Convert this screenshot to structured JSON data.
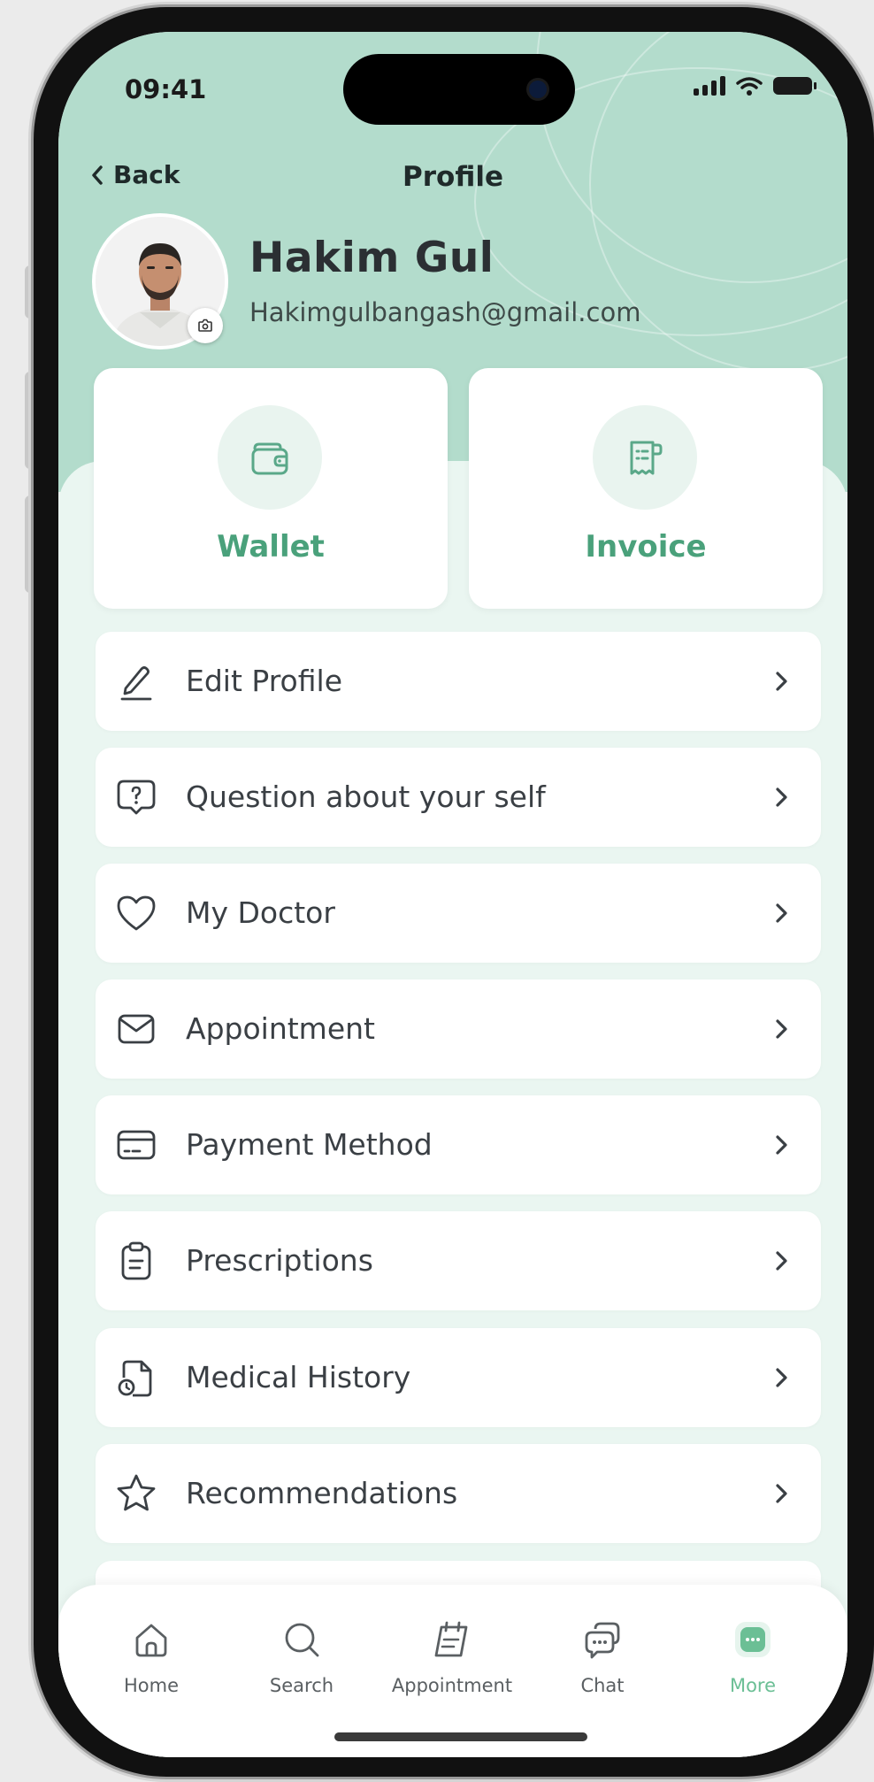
{
  "status_bar": {
    "time": "09:41"
  },
  "header": {
    "back_label": "Back",
    "title": "Profile"
  },
  "profile": {
    "name": "Hakim Gul",
    "email": "Hakimgulbangash@gmail.com"
  },
  "quick_cards": [
    {
      "label": "Wallet",
      "icon": "wallet-icon"
    },
    {
      "label": "Invoice",
      "icon": "invoice-icon"
    }
  ],
  "menu": [
    {
      "label": "Edit Profile",
      "icon": "pen-icon"
    },
    {
      "label": "Question about your self",
      "icon": "question-bubble-icon"
    },
    {
      "label": "My Doctor",
      "icon": "heart-icon"
    },
    {
      "label": "Appointment",
      "icon": "mail-icon"
    },
    {
      "label": "Payment Method",
      "icon": "card-icon"
    },
    {
      "label": "Prescriptions",
      "icon": "clipboard-icon"
    },
    {
      "label": "Medical History",
      "icon": "medical-history-icon"
    },
    {
      "label": "Recommendations",
      "icon": "star-icon"
    }
  ],
  "bottom_nav": [
    {
      "label": "Home",
      "icon": "home-icon"
    },
    {
      "label": "Search",
      "icon": "search-icon"
    },
    {
      "label": "Appointment",
      "icon": "calendar-icon"
    },
    {
      "label": "Chat",
      "icon": "chat-icon"
    },
    {
      "label": "More",
      "icon": "more-icon",
      "active": true
    }
  ],
  "colors": {
    "header_bg": "#b3dccc",
    "sheet_bg": "#eaf6f1",
    "accent": "#4aa17b",
    "nav_active": "#6bbf95"
  }
}
